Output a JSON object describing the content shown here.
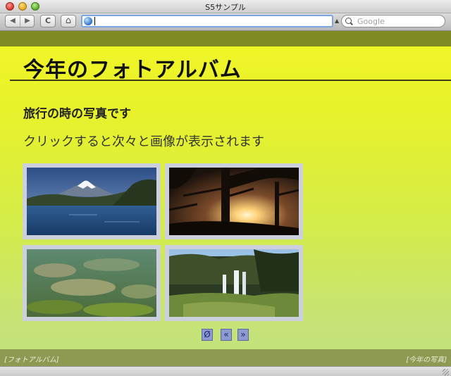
{
  "window": {
    "title": "S5サンプル"
  },
  "toolbar": {
    "back_label": "◀",
    "forward_label": "▶",
    "reload_label": "C",
    "home_label": "⌂",
    "url_value": "",
    "search_placeholder": "Google"
  },
  "slide": {
    "title": "今年のフォトアルバム",
    "subheading": "旅行の時の写真です",
    "body": "クリックすると次々と画像が表示されます",
    "photos": [
      {
        "icon": "mount-fuji-lake-photo"
      },
      {
        "icon": "sunset-trees-photo"
      },
      {
        "icon": "clear-water-stream-photo"
      },
      {
        "icon": "waterfall-forest-photo"
      }
    ],
    "nav": {
      "toggle_label": "Ø",
      "prev_label": "«",
      "next_label": "»"
    }
  },
  "footer": {
    "left": "[フォトアルバム]",
    "right": "[今年の写真]"
  },
  "colors": {
    "slide_top": "#f2f626",
    "slide_bottom": "#c2e07e",
    "header_band": "#7f8a22",
    "footer_band": "#8e9a52",
    "nav_button": "#8c9ad0"
  }
}
